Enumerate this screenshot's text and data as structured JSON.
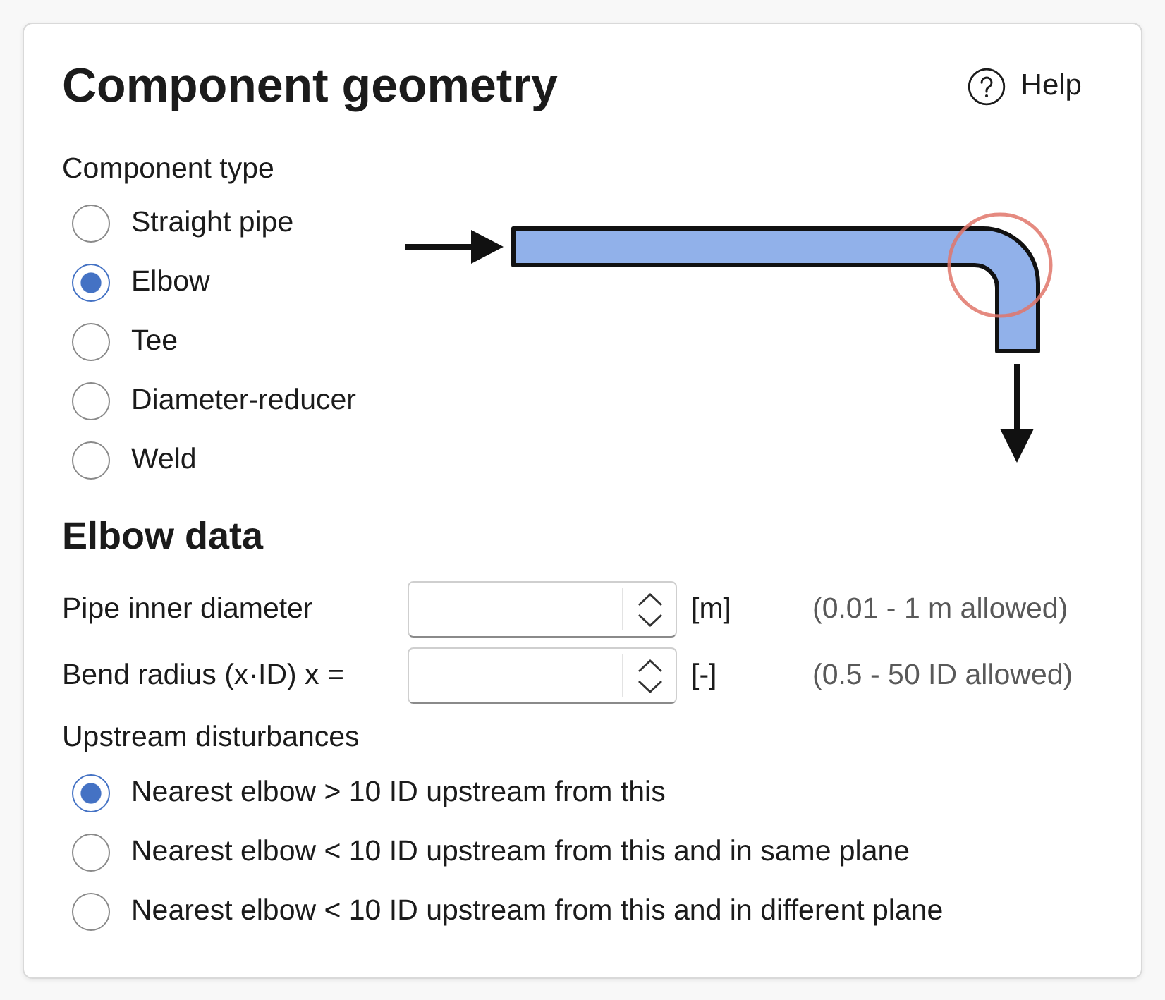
{
  "header": {
    "title": "Component geometry",
    "help_label": "Help"
  },
  "component_type": {
    "label": "Component type",
    "options": [
      {
        "label": "Straight pipe",
        "selected": false
      },
      {
        "label": "Elbow",
        "selected": true
      },
      {
        "label": "Tee",
        "selected": false
      },
      {
        "label": "Diameter-reducer",
        "selected": false
      },
      {
        "label": "Weld",
        "selected": false
      }
    ]
  },
  "elbow_data": {
    "title": "Elbow data",
    "fields": [
      {
        "label": "Pipe inner diameter",
        "unit": "[m]",
        "range": "(0.01 - 1 m allowed)"
      },
      {
        "label": "Bend radius (x·ID) x =",
        "unit": "[-]",
        "range": "(0.5 - 50 ID allowed)"
      }
    ]
  },
  "upstream_disturbances": {
    "label": "Upstream disturbances",
    "options": [
      {
        "label": "Nearest elbow > 10 ID upstream from this",
        "selected": true
      },
      {
        "label": "Nearest elbow < 10 ID upstream from this and in same plane",
        "selected": false
      },
      {
        "label": "Nearest elbow < 10 ID upstream from this and in different plane",
        "selected": false
      }
    ]
  }
}
